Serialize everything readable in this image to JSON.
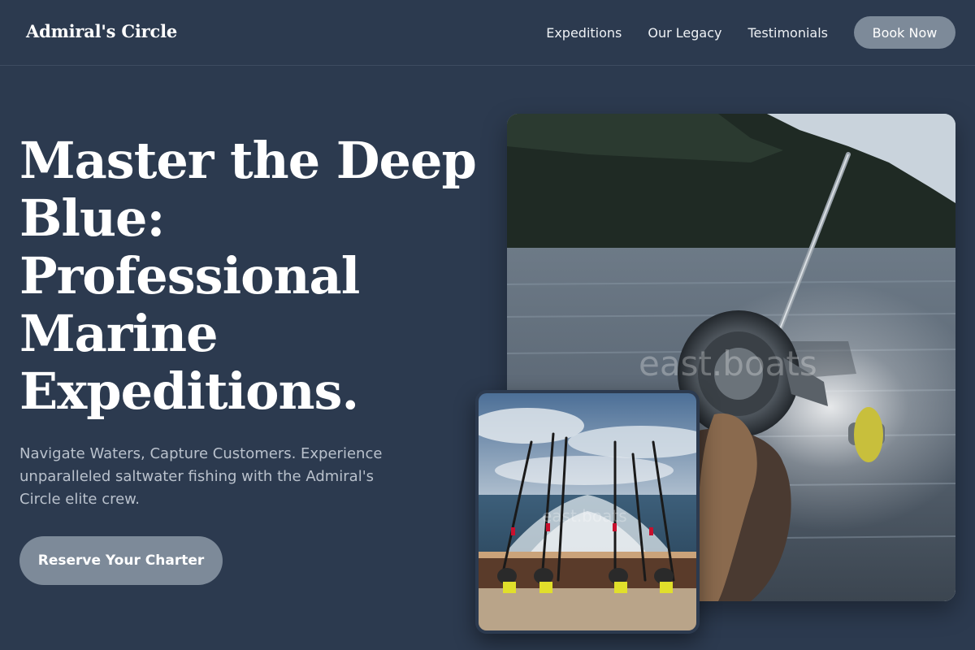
{
  "nav": {
    "brand": "Admiral's Circle",
    "links": [
      "Expeditions",
      "Our Legacy",
      "Testimonials"
    ],
    "cta": "Book Now"
  },
  "hero": {
    "title": "Master the Deep Blue: Professional Marine Expeditions.",
    "subtitle": "Navigate Waters, Capture Customers. Experience unparalleled saltwater fishing with the Admiral's Circle elite crew.",
    "cta": "Reserve Your Charter"
  },
  "images": {
    "watermark": "east.boats"
  },
  "colors": {
    "background": "#2c3a4f",
    "button": "#7d8a99",
    "text_muted": "#b9c1cc"
  }
}
